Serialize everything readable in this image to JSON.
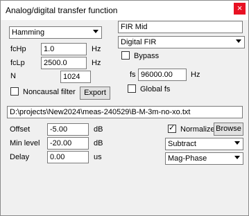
{
  "window": {
    "title": "Analog/digital transfer function",
    "close_symbol": "×"
  },
  "left": {
    "window_type": "Hamming",
    "fchp_label": "fcHp",
    "fchp_value": "1.0",
    "fchp_unit": "Hz",
    "fclp_label": "fcLp",
    "fclp_value": "2500.0",
    "fclp_unit": "Hz",
    "n_label": "N",
    "n_value": "1024",
    "noncausal_label": "Noncausal filter",
    "noncausal_checked": false,
    "export_label": "Export"
  },
  "right": {
    "name_value": "FIR Mid",
    "filter_type": "Digital FIR",
    "bypass_label": "Bypass",
    "bypass_checked": false,
    "fs_label": "fs",
    "fs_value": "96000.00",
    "fs_unit": "Hz",
    "globalfs_label": "Global fs",
    "globalfs_checked": false
  },
  "file_path": "D:\\projects\\New2024\\meas-240529\\B-M-3m-no-xo.txt",
  "bottom": {
    "offset_label": "Offset",
    "offset_value": "-5.00",
    "offset_unit": "dB",
    "minlevel_label": "Min level",
    "minlevel_value": "-20.00",
    "minlevel_unit": "dB",
    "delay_label": "Delay",
    "delay_value": "0.00",
    "delay_unit": "us",
    "normalize_label": "Normalize",
    "normalize_checked": true,
    "browse_label": "Browse",
    "mode_value": "Subtract",
    "display_value": "Mag-Phase"
  }
}
